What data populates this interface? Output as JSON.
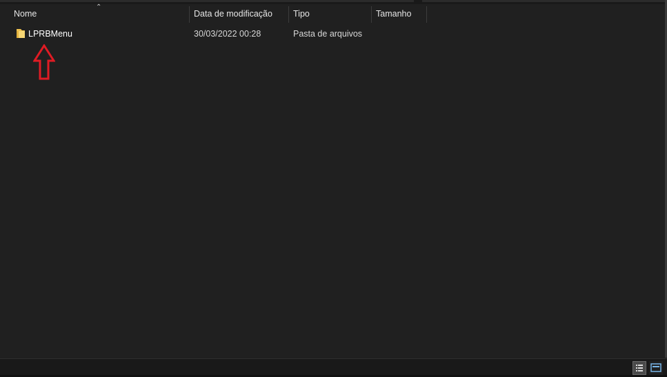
{
  "columns": {
    "name": "Nome",
    "date": "Data de modificação",
    "type": "Tipo",
    "size": "Tamanho"
  },
  "sort": {
    "column": "name",
    "icon": "sort-up-icon"
  },
  "files": [
    {
      "name": "LPRBMenu",
      "date": "30/03/2022 00:28",
      "type": "Pasta de arquivos",
      "size": "",
      "icon": "folder-icon"
    }
  ],
  "annotation": {
    "icon": "red-up-arrow-outline",
    "color": "#e01b24"
  },
  "status_bar": {
    "view_details_icon": "details-view-icon",
    "view_tiles_icon": "large-icons-view-icon"
  },
  "colors": {
    "background": "#202020",
    "header_text": "#e6e6e6",
    "folder": "#f4c95d"
  }
}
